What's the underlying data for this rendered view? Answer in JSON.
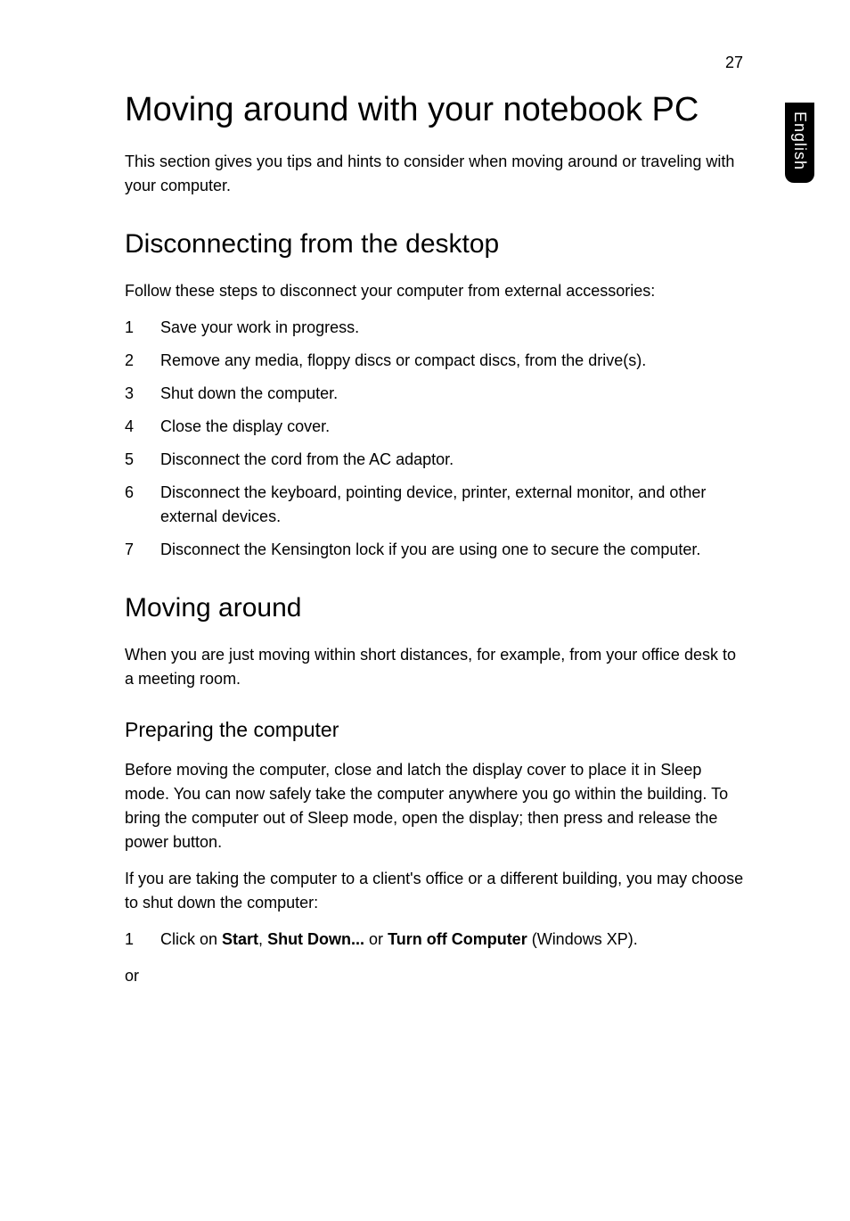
{
  "pageNumber": "27",
  "sideTab": "English",
  "h1": "Moving around with your notebook PC",
  "intro": "This section gives you tips and hints to consider when moving around or traveling with your computer.",
  "section1": {
    "heading": "Disconnecting from the desktop",
    "intro": "Follow these steps to disconnect your computer from external accessories:",
    "steps": [
      "Save your work in progress.",
      "Remove any media, floppy discs or compact discs, from the drive(s).",
      "Shut down the computer.",
      "Close the display cover.",
      "Disconnect the cord from the AC adaptor.",
      "Disconnect the keyboard, pointing device, printer, external monitor, and other external devices.",
      "Disconnect the Kensington lock if you are using one to secure the computer."
    ]
  },
  "section2": {
    "heading": "Moving around",
    "intro": "When you are just moving within short distances, for example, from your office desk to a meeting room.",
    "subheading": "Preparing the computer",
    "para1": "Before moving the computer, close and latch the display cover to place it in Sleep mode. You can now safely take the computer anywhere you go within the building. To bring the computer out of Sleep mode, open the display; then press and release the power button.",
    "para2": "If you are taking the computer to a client's office or a different building, you may choose to shut down the computer:",
    "step1_prefix": "Click on ",
    "step1_bold1": "Start",
    "step1_sep1": ", ",
    "step1_bold2": "Shut Down...",
    "step1_mid": " or ",
    "step1_bold3": "Turn off Computer",
    "step1_suffix": " (Windows XP).",
    "or": "or"
  }
}
